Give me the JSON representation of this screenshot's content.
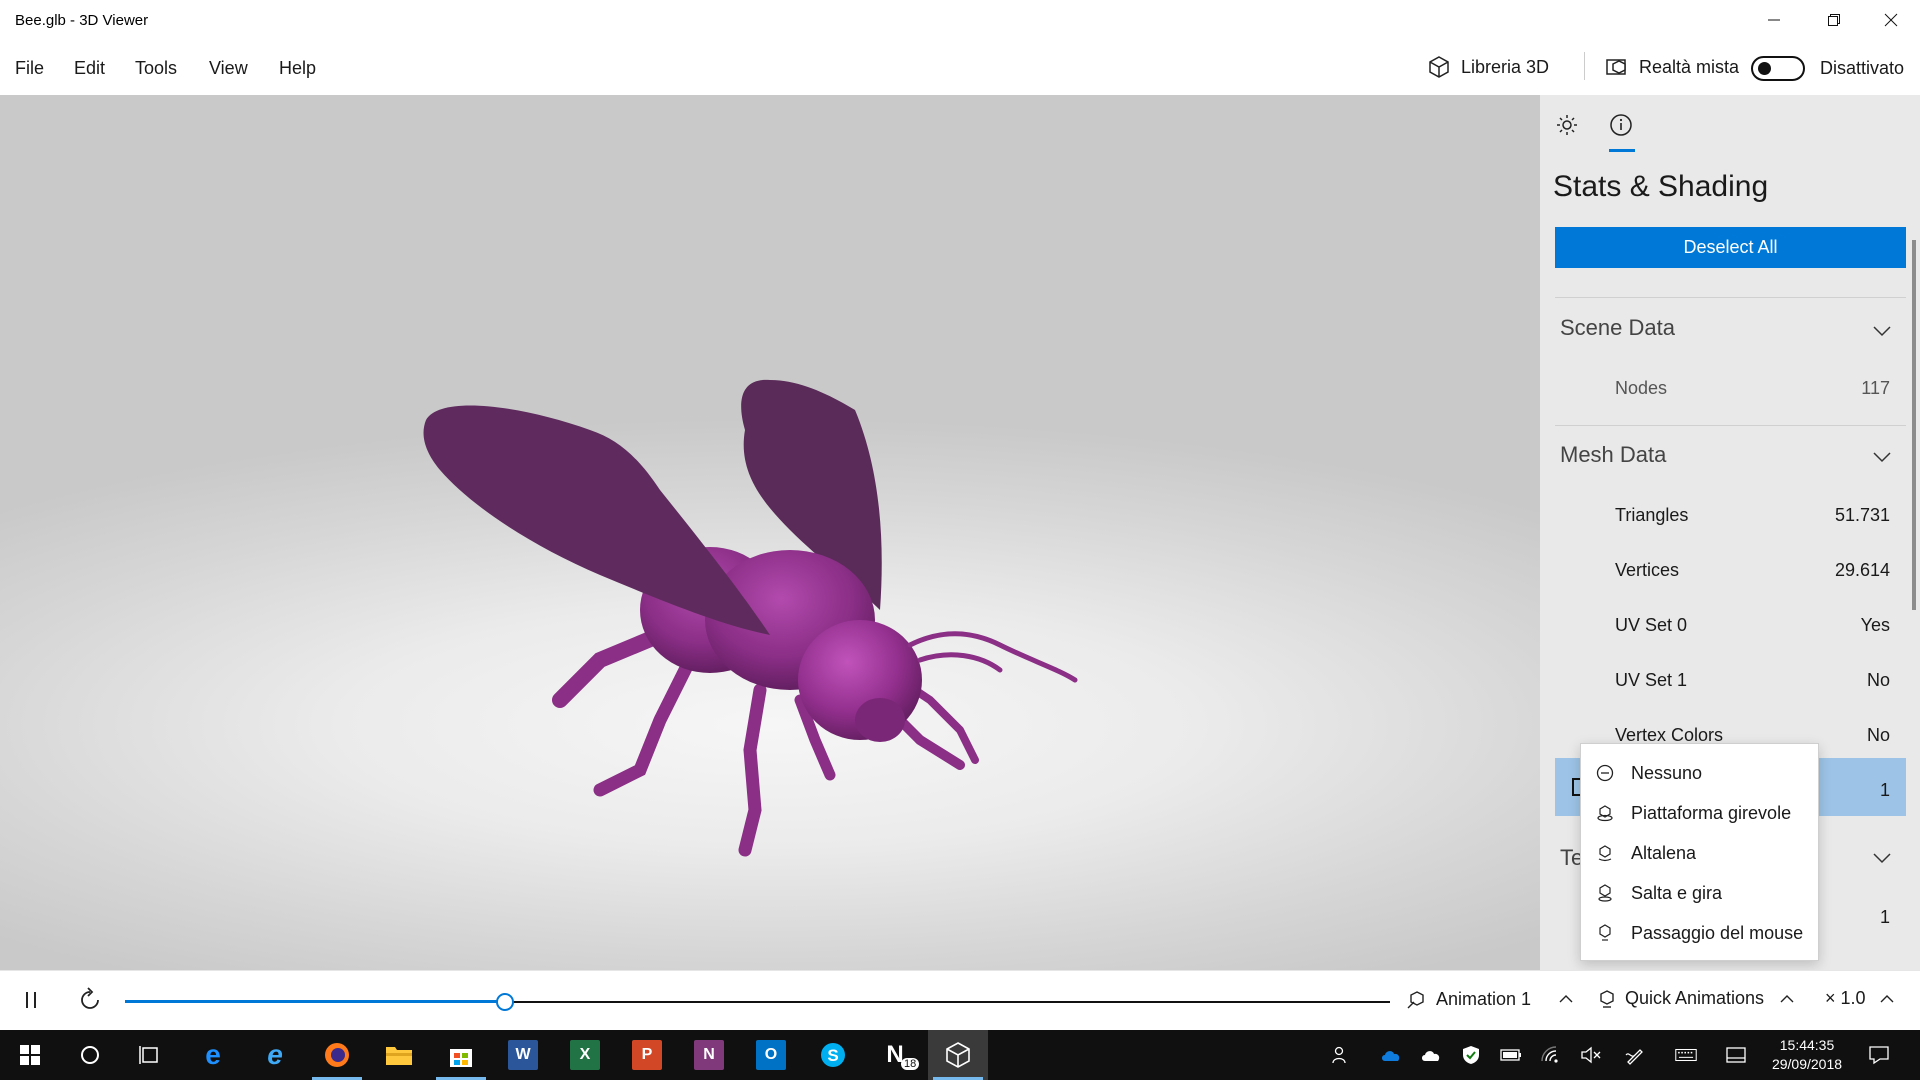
{
  "window": {
    "title": "Bee.glb - 3D Viewer"
  },
  "menu": {
    "file": "File",
    "edit": "Edit",
    "tools": "Tools",
    "view": "View",
    "help": "Help"
  },
  "header": {
    "library": "Libreria 3D",
    "mixed_reality": "Realtà mista",
    "toggle_state": "Disattivato"
  },
  "panel": {
    "title": "Stats & Shading",
    "deselect": "Deselect All",
    "scene": {
      "title": "Scene Data",
      "nodes_label": "Nodes",
      "nodes_value": "117"
    },
    "mesh": {
      "title": "Mesh Data",
      "triangles_label": "Triangles",
      "triangles_value": "51.731",
      "vertices_label": "Vertices",
      "vertices_value": "29.614",
      "uv0_label": "UV Set 0",
      "uv0_value": "Yes",
      "uv1_label": "UV Set 1",
      "uv1_value": "No",
      "vcolors_label": "Vertex Colors",
      "vcolors_value": "No",
      "selected_value": "1"
    },
    "textures": {
      "title_partial": "Te",
      "value": "1"
    }
  },
  "dropdown": {
    "items": [
      "Nessuno",
      "Piattaforma girevole",
      "Altalena",
      "Salta e gira",
      "Passaggio del mouse"
    ]
  },
  "animbar": {
    "animation": "Animation 1",
    "quick": "Quick Animations",
    "speed": "× 1.0",
    "progress": 0.3
  },
  "taskbar": {
    "time": "15:44:35",
    "date": "29/09/2018",
    "notes_badge": "18"
  },
  "colors": {
    "accent": "#0078d7",
    "model": "#8a2e86",
    "selection": "#9dc4e7"
  }
}
